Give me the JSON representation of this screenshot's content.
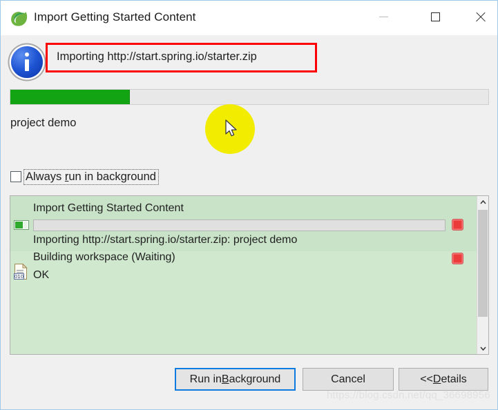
{
  "window": {
    "title": "Import Getting Started Content",
    "app_icon": "spring-leaf-icon",
    "controls": {
      "minimize": "minimize-icon",
      "maximize": "maximize-icon",
      "close": "close-icon"
    }
  },
  "info": {
    "icon": "info-circle-icon",
    "message": "Importing http://start.spring.io/starter.zip",
    "highlight_color": "#fb0000"
  },
  "progress": {
    "percent": 25,
    "fill_color": "#13a413",
    "label": "project demo"
  },
  "checkbox": {
    "label_before": "Always ",
    "label_mnemonic": "r",
    "label_after": "un in background",
    "checked": false
  },
  "details": {
    "groups": [
      {
        "title": "Import Getting Started Content",
        "icon": "task-progress-icon",
        "inner_progress_percent": 0,
        "subtitle": "Importing http://start.spring.io/starter.zip: project demo",
        "stop_icon": "stop-icon"
      },
      {
        "title": "Building workspace (Waiting)",
        "icon": "binary-file-icon",
        "subtitle": "OK",
        "stop_icon": "stop-icon"
      }
    ],
    "scrollbar": {
      "up_icon": "chevron-up-icon",
      "down_icon": "chevron-down-icon"
    }
  },
  "buttons": {
    "run_in_background": {
      "before": "Run in ",
      "mnemonic": "B",
      "after": "ackground"
    },
    "cancel": "Cancel",
    "details": {
      "before": "<< ",
      "mnemonic": "D",
      "after": "etails"
    }
  },
  "watermark": "https://blog.csdn.net/qq_36698956"
}
